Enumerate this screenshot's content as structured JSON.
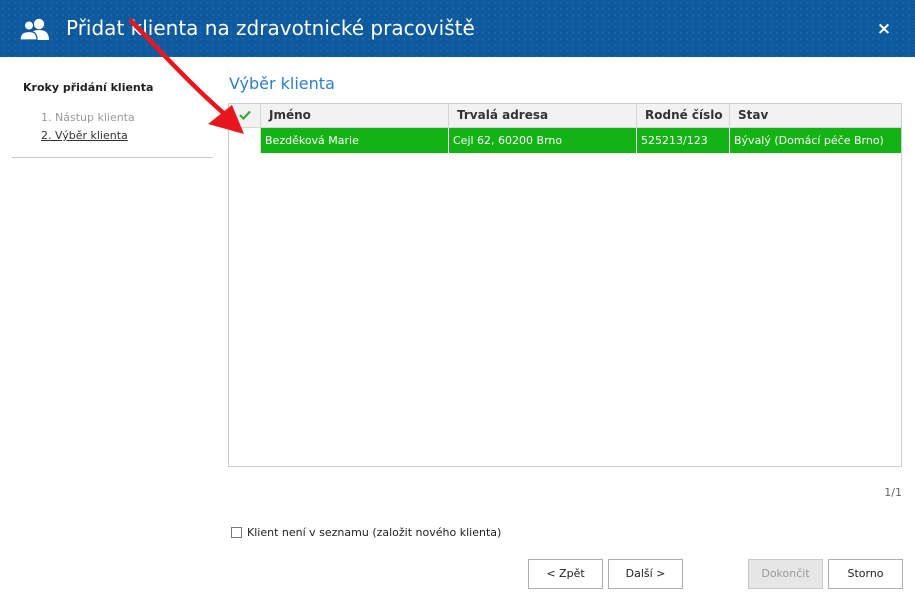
{
  "window": {
    "title": "Přidat klienta na zdravotnické pracoviště",
    "icon": "users-icon",
    "close_glyph": "×"
  },
  "sidebar": {
    "title": "Kroky přidání klienta",
    "steps": [
      {
        "label": "1. Nástup klienta",
        "state": "completed"
      },
      {
        "label": "2. Výběr klienta",
        "state": "current"
      }
    ]
  },
  "main": {
    "title": "Výběr klienta",
    "table": {
      "check_icon": "✔",
      "columns": [
        "Jméno",
        "Trvalá adresa",
        "Rodné číslo",
        "Stav"
      ],
      "rows": [
        {
          "selected": true,
          "cells": [
            "Bezděková Marie",
            "Cejl 62, 60200 Brno",
            "525213/123",
            "Bývalý (Domácí péče Brno)"
          ]
        }
      ]
    },
    "pager": "1/1",
    "new_client_checkbox": {
      "label": "Klient není v seznamu (založit nového klienta)",
      "checked": false
    }
  },
  "buttons": {
    "back": "< Zpět",
    "next": "Další >",
    "finish": "Dokončit",
    "cancel": "Storno"
  },
  "colors": {
    "titlebar": "#0e5a9e",
    "accent": "#2f7fc1",
    "selected_row": "#12b312",
    "check": "#3aa83a",
    "annotation_arrow": "#e8171d"
  }
}
